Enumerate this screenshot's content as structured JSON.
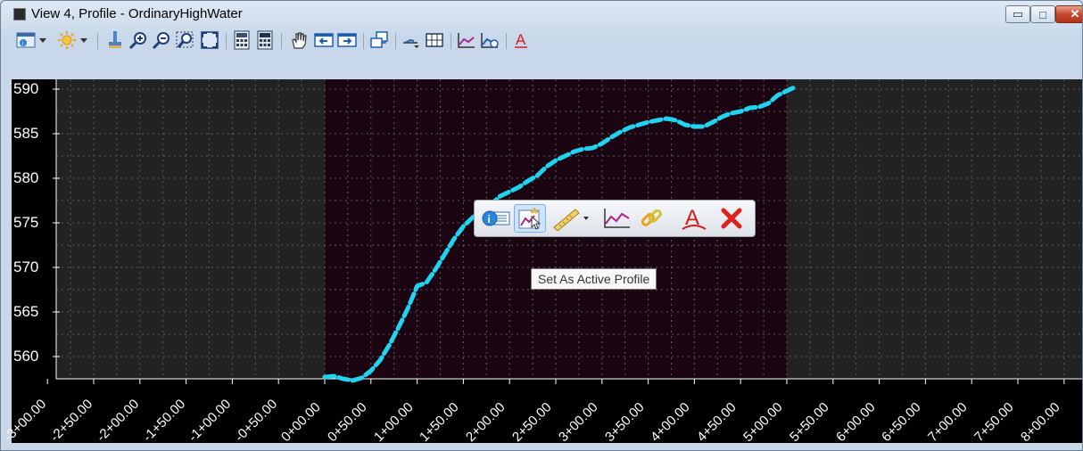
{
  "window": {
    "title": "View 4, Profile - OrdinaryHighWater",
    "controls": {
      "minimize": "▭",
      "maximize": "□",
      "close": "✕"
    }
  },
  "toolbar": {
    "icons": [
      "view-attributes-icon",
      "dropdown-icon",
      "display-style-icon",
      "dropdown-icon",
      "update-view-icon",
      "zoom-in-icon",
      "zoom-out-icon",
      "window-area-icon",
      "fit-view-icon",
      "calculator-icon",
      "calculator-alt-icon",
      "pan-icon",
      "previous-view-icon",
      "next-view-icon",
      "copy-view-icon",
      "profile-settings-icon",
      "grid-icon",
      "profile-icon",
      "profile-edit-icon",
      "annotate-icon"
    ]
  },
  "profile_view": {
    "background": "#222222",
    "active_region_color": "#1b0513",
    "line_color": "#22d3ee",
    "y_ticks": [
      "590",
      "585",
      "580",
      "575",
      "570",
      "565",
      "560"
    ],
    "x_ticks": [
      "-3+00.00",
      "-2+50.00",
      "-2+00.00",
      "-1+50.00",
      "-1+00.00",
      "-0+50.00",
      "0+00.00",
      "0+50.00",
      "1+00.00",
      "1+50.00",
      "2+00.00",
      "2+50.00",
      "3+00.00",
      "3+50.00",
      "4+00.00",
      "4+50.00",
      "5+00.00",
      "5+50.00",
      "6+00.00",
      "6+50.00",
      "7+00.00",
      "7+50.00",
      "8+00.00"
    ]
  },
  "chart_data": {
    "type": "line",
    "x_unit": "station (ft)",
    "xlim": [
      -300,
      800
    ],
    "ylim": [
      557.5,
      591
    ],
    "grid": true,
    "series": [
      {
        "x": [
          0,
          10,
          20,
          30,
          40,
          50,
          60,
          70,
          80,
          90,
          100,
          110,
          120,
          130,
          140,
          150,
          160,
          170,
          180,
          190,
          200,
          210,
          220,
          230,
          240,
          250,
          260,
          270,
          280,
          290,
          300,
          310,
          320,
          330,
          340,
          350,
          360,
          370,
          380,
          390,
          400,
          410,
          420,
          430,
          440,
          450,
          460,
          470,
          480,
          490,
          500,
          510
        ],
        "y": [
          557.7,
          557.8,
          557.5,
          557.3,
          557.6,
          558.4,
          559.6,
          561.3,
          563.3,
          565.4,
          567.9,
          568.3,
          569.8,
          571.5,
          573.2,
          574.6,
          575.6,
          576.4,
          577.1,
          578.0,
          578.5,
          579.0,
          579.7,
          580.3,
          581.3,
          582.0,
          582.5,
          583.0,
          583.3,
          583.4,
          583.9,
          584.6,
          585.2,
          585.7,
          586.0,
          586.3,
          586.5,
          586.7,
          586.5,
          586.0,
          585.8,
          585.8,
          586.3,
          586.9,
          587.3,
          587.5,
          587.9,
          588.0,
          588.4,
          589.3,
          589.8,
          590.3
        ]
      }
    ]
  },
  "context_toolbar": {
    "buttons": [
      "properties-icon",
      "set-active-profile-icon",
      "measure-icon",
      "profile-graph-icon",
      "link-icon",
      "annotate-icon",
      "delete-icon"
    ]
  },
  "tooltip": {
    "text": "Set As Active Profile"
  }
}
